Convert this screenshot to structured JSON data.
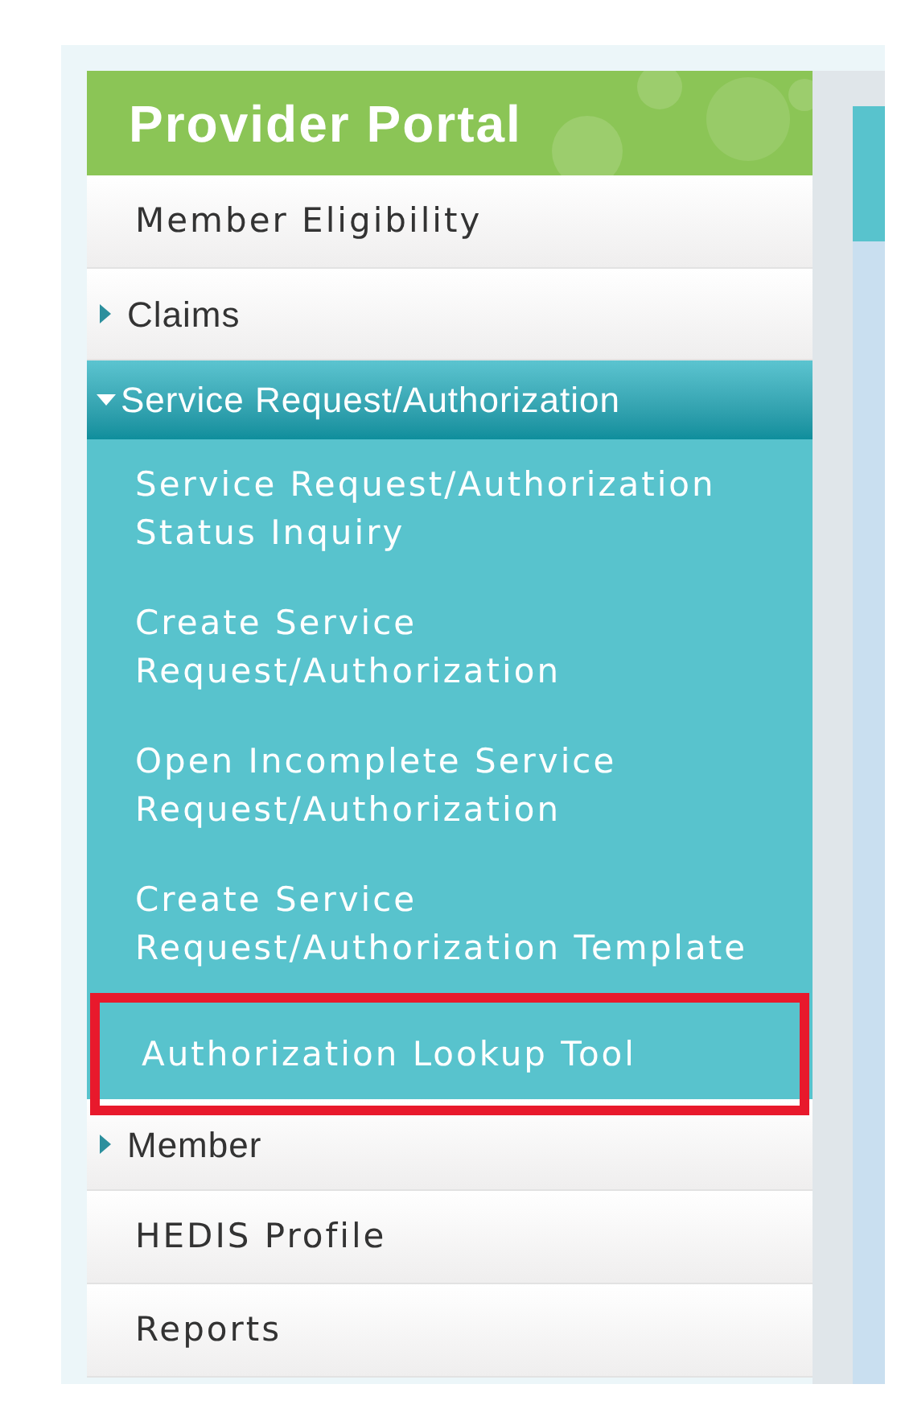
{
  "portal": {
    "title": "Provider Portal"
  },
  "nav": [
    {
      "kind": "link",
      "label": "Member Eligibility"
    },
    {
      "kind": "group",
      "label": "Claims",
      "expanded": false
    },
    {
      "kind": "group",
      "label": "Service Request/Authorization",
      "expanded": true,
      "children": [
        {
          "label": "Service Request/Authorization Status Inquiry",
          "highlighted": false
        },
        {
          "label": "Create Service Request/Authorization",
          "highlighted": false
        },
        {
          "label": "Open Incomplete Service Request/Authorization",
          "highlighted": false
        },
        {
          "label": "Create Service Request/Authorization Template",
          "highlighted": false
        },
        {
          "label": "Authorization Lookup Tool",
          "highlighted": true
        }
      ]
    },
    {
      "kind": "group",
      "label": "Member",
      "expanded": false
    },
    {
      "kind": "link",
      "label": "HEDIS Profile"
    },
    {
      "kind": "link",
      "label": "Reports"
    }
  ]
}
